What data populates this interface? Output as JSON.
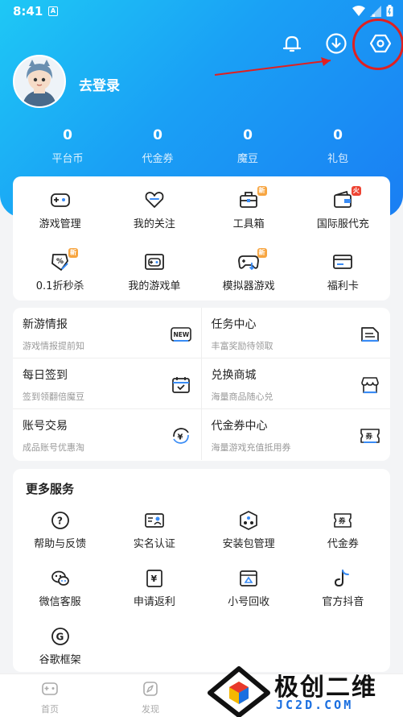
{
  "status_bar": {
    "time": "8:41",
    "a_icon": "A"
  },
  "header": {
    "login_text": "去登录",
    "icons": [
      "bell-icon",
      "download-icon",
      "settings-icon"
    ]
  },
  "stats": [
    {
      "value": "0",
      "label": "平台币"
    },
    {
      "value": "0",
      "label": "代金券"
    },
    {
      "value": "0",
      "label": "魔豆"
    },
    {
      "value": "0",
      "label": "礼包"
    }
  ],
  "tools": [
    {
      "label": "游戏管理",
      "icon": "gamepad-icon"
    },
    {
      "label": "我的关注",
      "icon": "heart-icon"
    },
    {
      "label": "工具箱",
      "icon": "toolbox-icon",
      "badge": "新"
    },
    {
      "label": "国际服代充",
      "icon": "wallet-icon",
      "badge": "火"
    },
    {
      "label": "0.1折秒杀",
      "icon": "discount-icon",
      "badge": "新"
    },
    {
      "label": "我的游戏单",
      "icon": "game-list-icon"
    },
    {
      "label": "模拟器游戏",
      "icon": "emulator-icon",
      "badge": "新"
    },
    {
      "label": "福利卡",
      "icon": "card-icon"
    }
  ],
  "tasks": [
    {
      "title": "新游情报",
      "sub": "游戏情报提前知",
      "icon": "new-icon",
      "icon_text": "NEW"
    },
    {
      "title": "任务中心",
      "sub": "丰富奖励待领取",
      "icon": "task-icon"
    },
    {
      "title": "每日签到",
      "sub": "签到领翻倍魔豆",
      "icon": "calendar-icon"
    },
    {
      "title": "兑换商城",
      "sub": "海量商品随心兑",
      "icon": "shop-icon"
    },
    {
      "title": "账号交易",
      "sub": "成品账号优惠淘",
      "icon": "trade-icon",
      "icon_text": "¥"
    },
    {
      "title": "代金券中心",
      "sub": "海量游戏充值抵用券",
      "icon": "coupon-icon",
      "icon_text": "券"
    }
  ],
  "more": {
    "title": "更多服务",
    "items": [
      {
        "label": "帮助与反馈",
        "icon": "help-icon",
        "icon_text": "?"
      },
      {
        "label": "实名认证",
        "icon": "id-card-icon"
      },
      {
        "label": "安装包管理",
        "icon": "package-icon"
      },
      {
        "label": "代金券",
        "icon": "voucher-icon",
        "icon_text": "券"
      },
      {
        "label": "微信客服",
        "icon": "wechat-icon"
      },
      {
        "label": "申请返利",
        "icon": "rebate-icon",
        "icon_text": "¥"
      },
      {
        "label": "小号回收",
        "icon": "recycle-icon"
      },
      {
        "label": "官方抖音",
        "icon": "tiktok-icon"
      },
      {
        "label": "谷歌框架",
        "icon": "google-icon",
        "icon_text": "G"
      }
    ]
  },
  "bottom_nav": [
    {
      "label": "首页",
      "icon": "home-icon"
    },
    {
      "label": "发现",
      "icon": "discover-icon"
    }
  ],
  "watermark": {
    "text": "极创二维",
    "sub": "JC2D.COM"
  },
  "colors": {
    "accent": "#1a8cf5",
    "annotation": "#e02020"
  }
}
